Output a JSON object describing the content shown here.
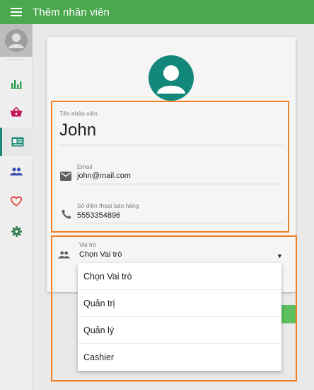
{
  "appbar": {
    "title": "Thêm nhân viên"
  },
  "sidenav": {
    "items": [
      {
        "name": "bar-chart-icon",
        "color": "#2e9b4a"
      },
      {
        "name": "basket-icon",
        "color": "#c2185b"
      },
      {
        "name": "id-card-icon",
        "color": "#1e8a78",
        "active": true
      },
      {
        "name": "people-icon",
        "color": "#3f51b5"
      },
      {
        "name": "heart-icon",
        "color": "#e53935"
      },
      {
        "name": "gear-icon",
        "color": "#2e7d52"
      }
    ]
  },
  "form": {
    "name_label": "Tên nhân viên",
    "name_value": "John",
    "email_label": "Email",
    "email_value": "john@mail.com",
    "phone_label": "Số điện thoại bán hàng",
    "phone_value": "5553354896",
    "role_label": "Vai trò",
    "role_value": "Chọn Vai trò"
  },
  "role_options": [
    "Chọn Vai trò",
    "Quản trị",
    "Quản lý",
    "Cashier"
  ],
  "colors": {
    "appbar": "#4aa84f",
    "accent": "#12877a",
    "highlight": "#f07f24"
  }
}
